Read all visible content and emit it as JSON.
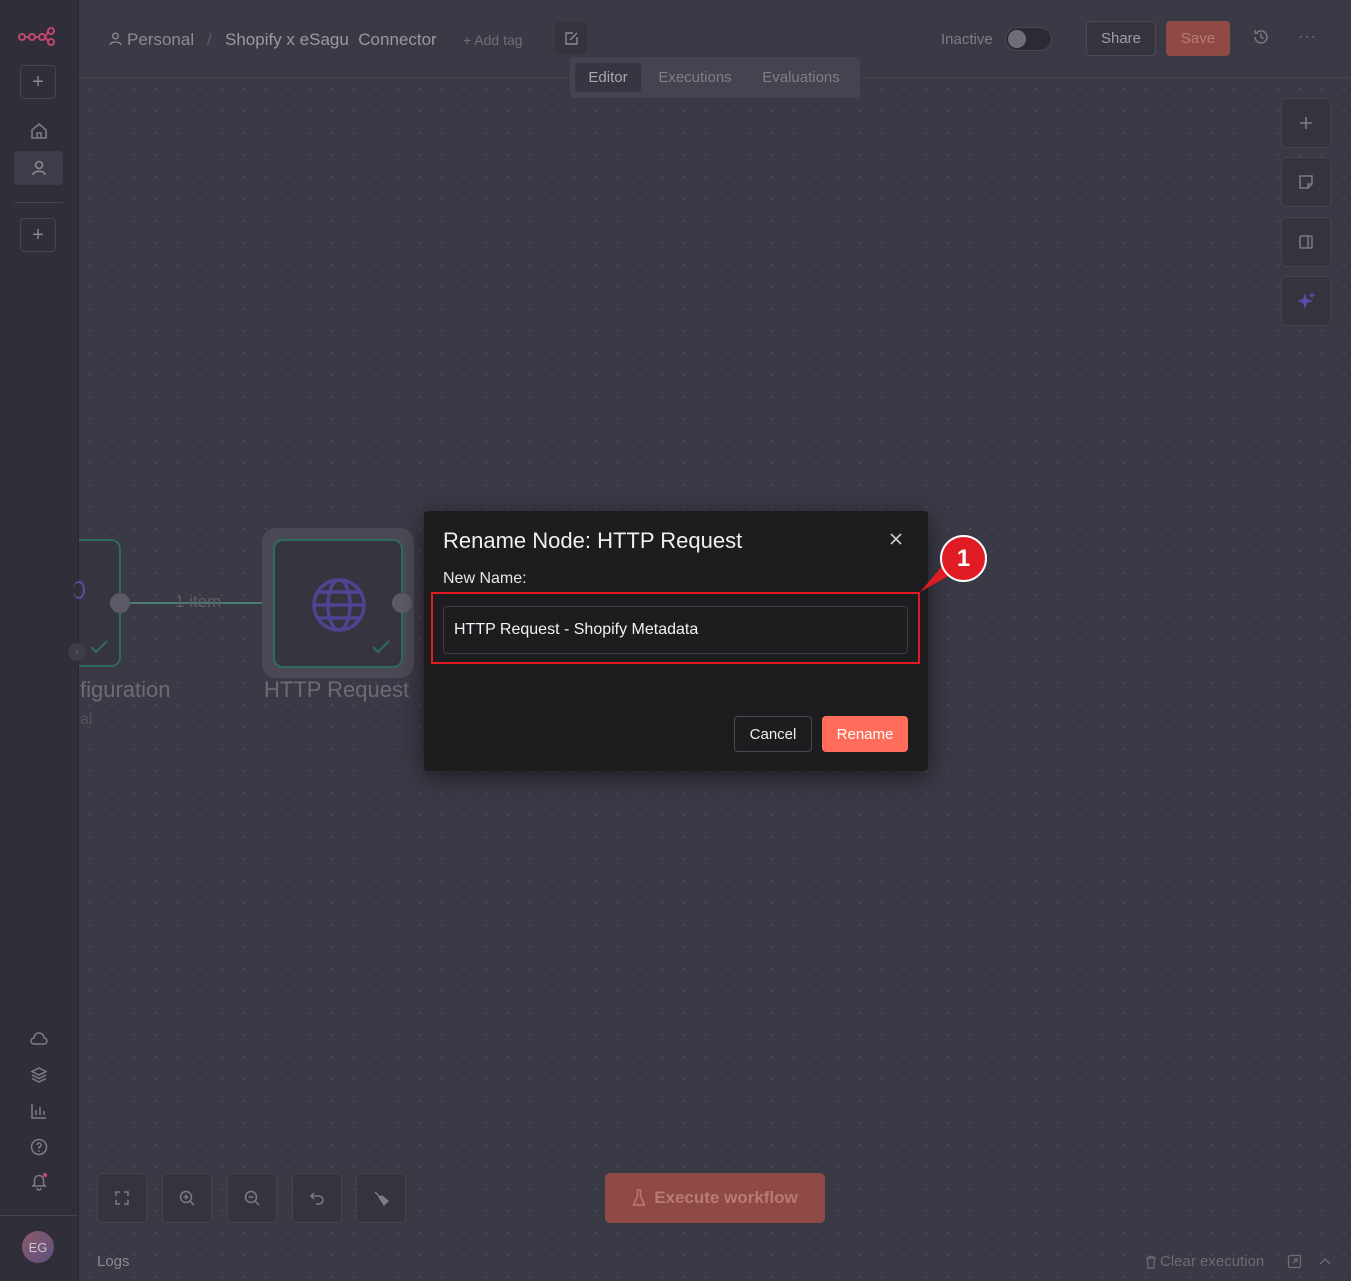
{
  "header": {
    "project": "Personal",
    "separator": "/",
    "workflow_name": "Shopify x eSagu  Connector",
    "add_tag": "+ Add tag",
    "status_label": "Inactive",
    "share_label": "Share",
    "save_label": "Save"
  },
  "tabs": [
    "Editor",
    "Executions",
    "Evaluations"
  ],
  "canvas": {
    "node_left_label": "figuration",
    "node_left_sub": "al",
    "connection_label": "1 item",
    "node_http_label": "HTTP Request"
  },
  "modal": {
    "title": "Rename Node: HTTP Request",
    "field_label": "New Name:",
    "input_value": "HTTP Request - Shopify Metadata",
    "cancel_label": "Cancel",
    "rename_label": "Rename",
    "annotation_number": "1"
  },
  "footer": {
    "execute_label": "Execute workflow",
    "logs_label": "Logs",
    "clear_label": "Clear execution"
  },
  "user": {
    "initials": "EG"
  },
  "colors": {
    "accent": "#ff6d5a",
    "annotation": "#e01b24",
    "success": "#3a9d7a",
    "node_icon": "#6b5fc7"
  }
}
